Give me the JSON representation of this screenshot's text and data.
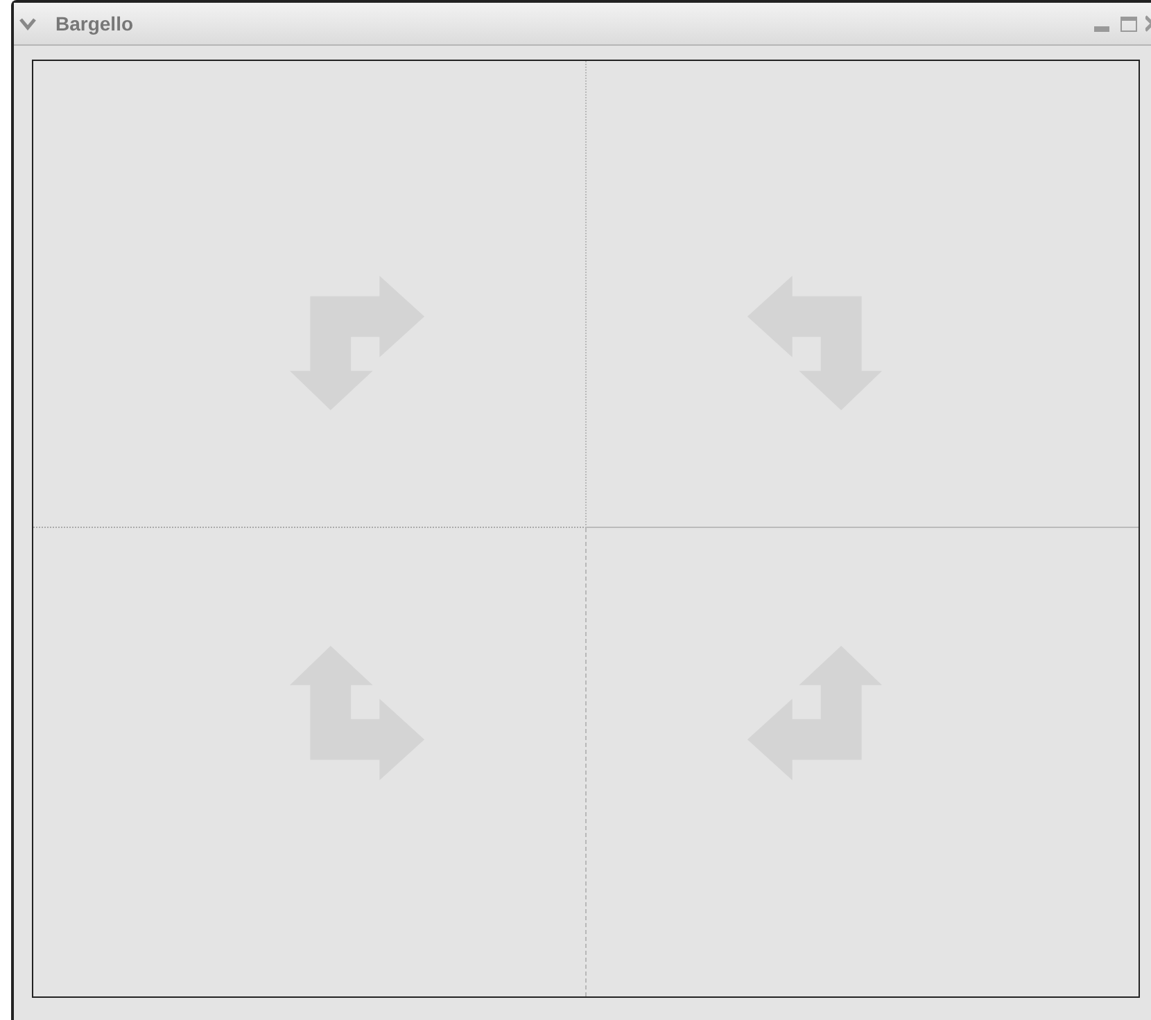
{
  "window": {
    "title": "Bargello"
  }
}
